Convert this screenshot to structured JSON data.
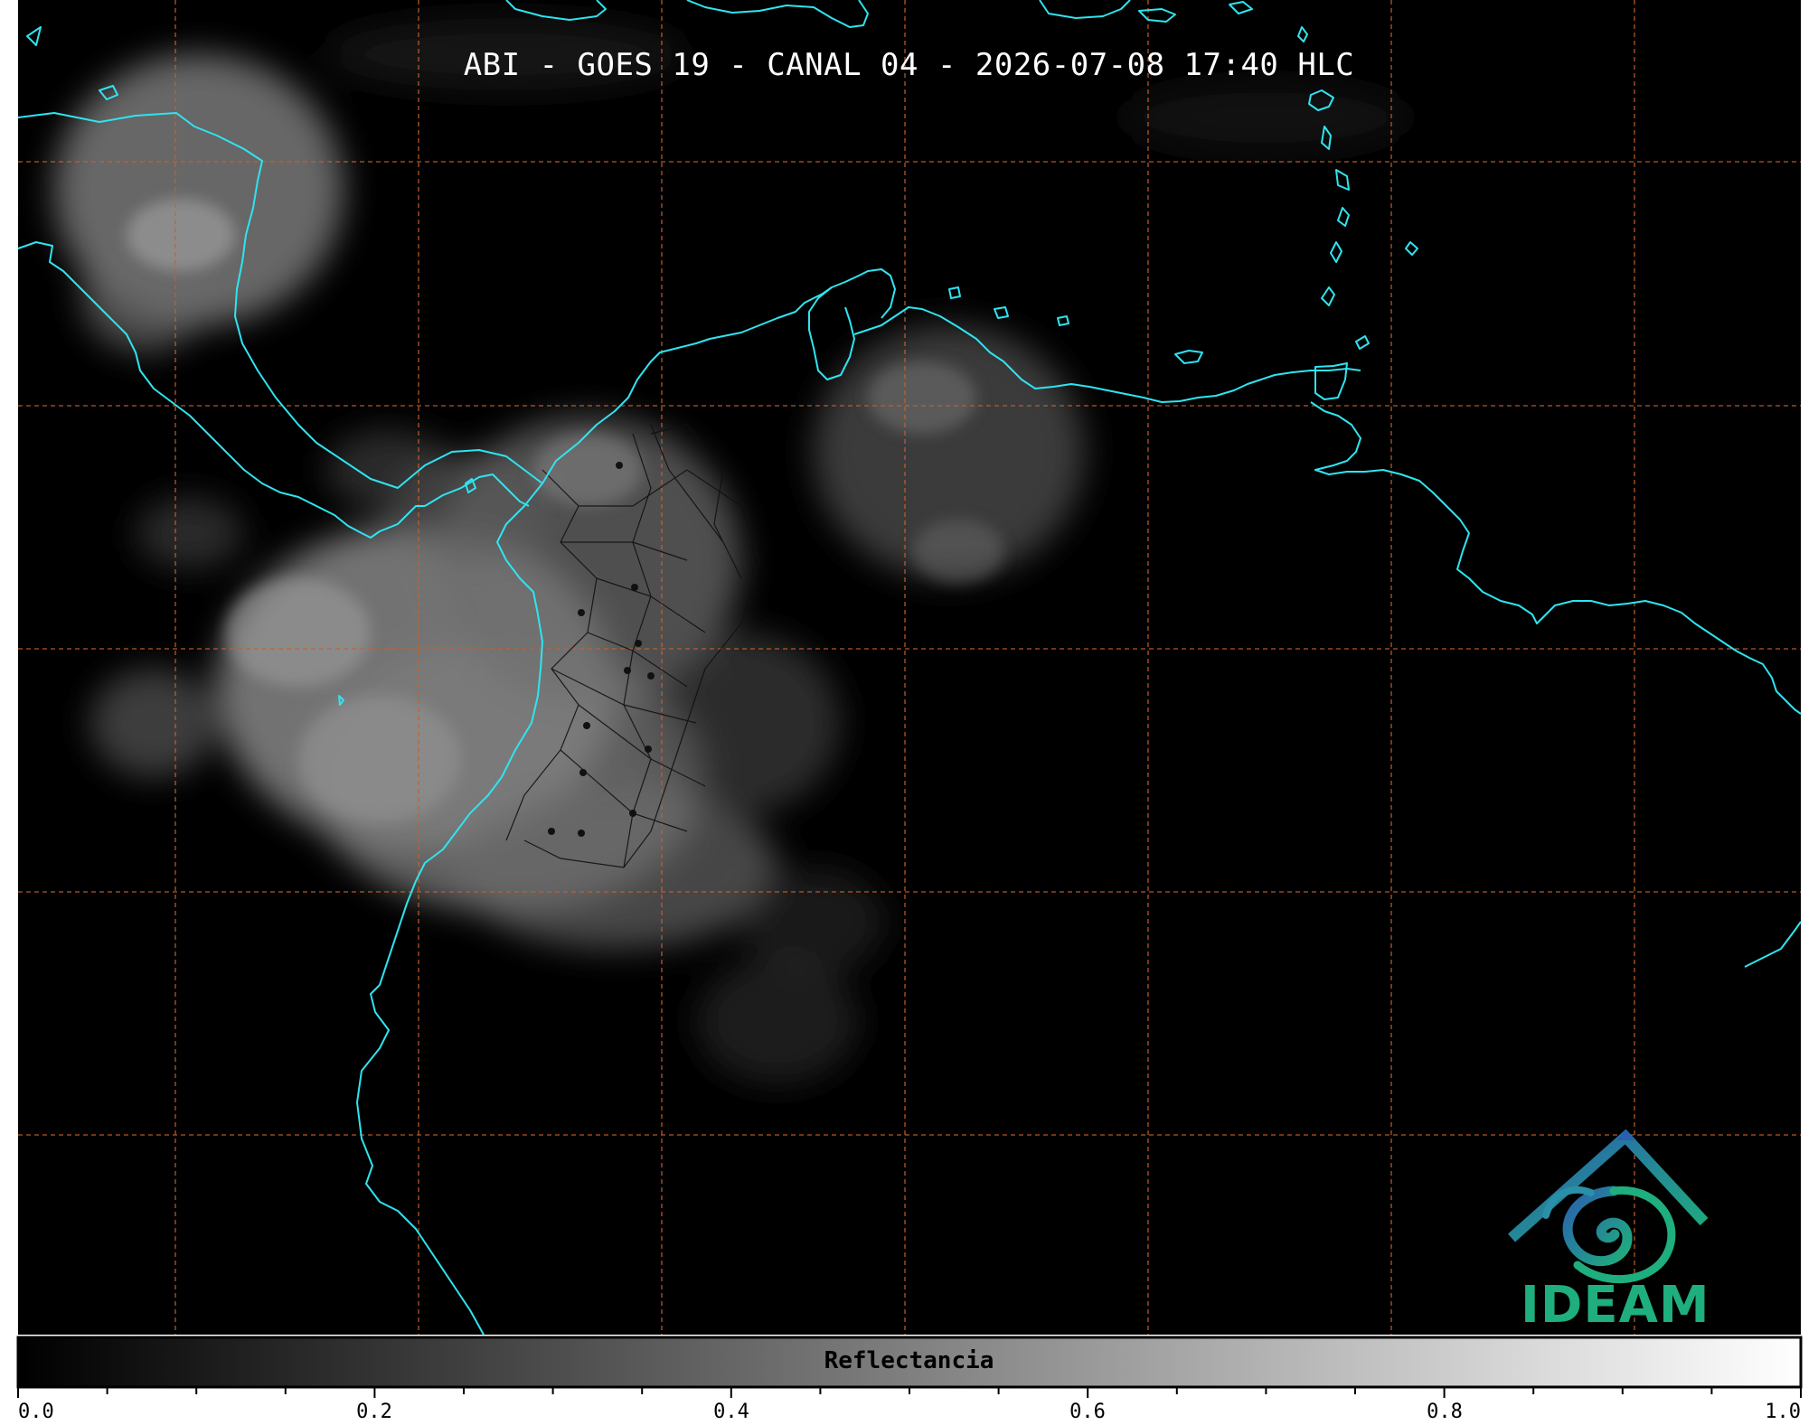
{
  "title": "ABI - GOES 19 - CANAL 04 - 2026-07-08 17:40 HLC",
  "colorbar": {
    "label": "Reflectancia",
    "ticks": [
      "0.0",
      "0.2",
      "0.4",
      "0.6",
      "0.8",
      "1.0"
    ],
    "range": [
      0.0,
      1.0
    ],
    "colormap": [
      "#000000",
      "#ffffff"
    ]
  },
  "logo": {
    "text": "IDEAM"
  },
  "colors": {
    "coastline": "#2fe4f0",
    "graticule": "#c7622a",
    "background": "#000000",
    "logo_blue": "#2a5fb0",
    "logo_teal": "#1fae7d"
  }
}
